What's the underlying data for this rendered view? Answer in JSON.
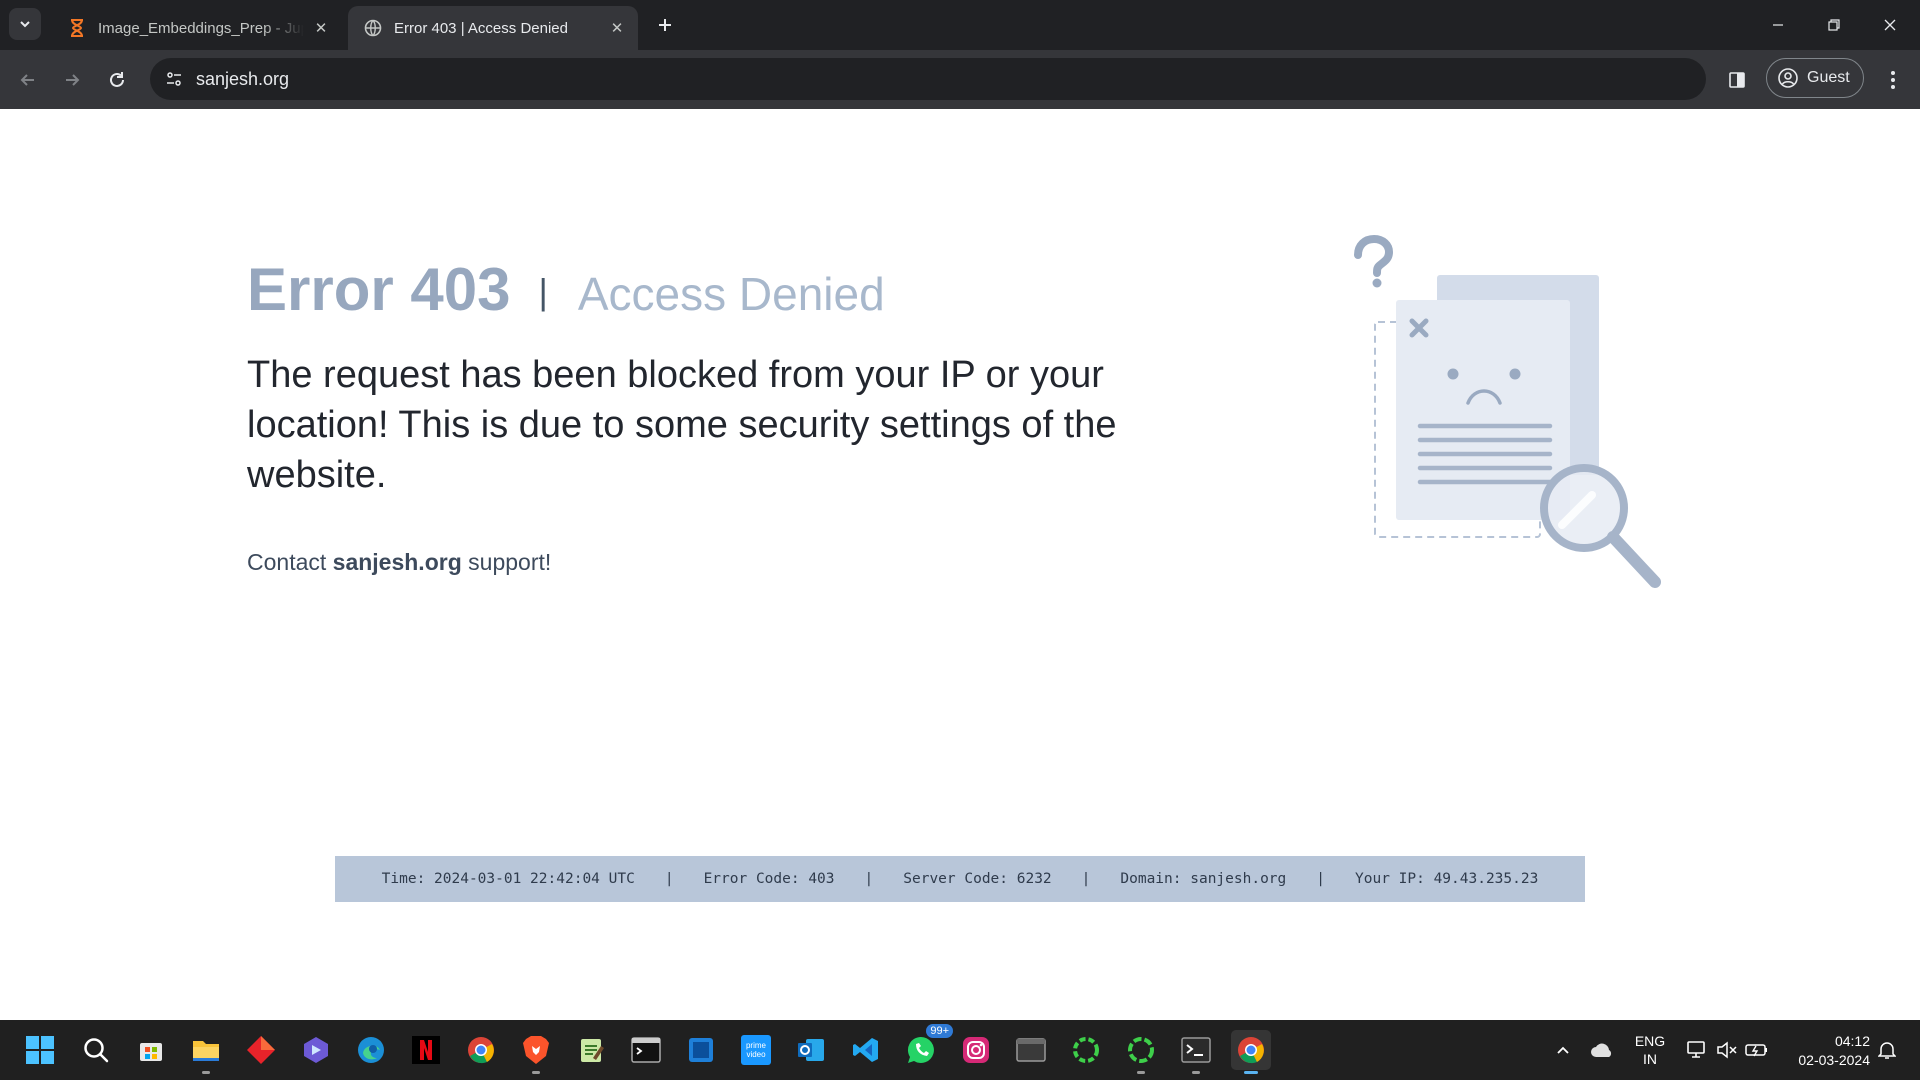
{
  "browser": {
    "tabs": [
      {
        "title": "Image_Embeddings_Prep - Jupyter",
        "icon": "hourglass-icon",
        "active": false
      },
      {
        "title": "Error 403  | Access Denied",
        "icon": "globe-icon",
        "active": true
      }
    ],
    "url": "sanjesh.org",
    "profile_label": "Guest"
  },
  "page": {
    "error_code": "Error 403",
    "separator": "|",
    "error_title": "Access Denied",
    "message": "The request has been blocked from your IP or your location! This is due to some security settings of the website.",
    "contact_prefix": "Contact ",
    "contact_domain": "sanjesh.org",
    "contact_suffix": " support!",
    "info": {
      "time": "Time: 2024-03-01 22:42:04 UTC",
      "error_code": "Error Code: 403",
      "server_code": "Server Code: 6232",
      "domain": "Domain: sanjesh.org",
      "ip": "Your IP: 49.43.235.23"
    }
  },
  "taskbar": {
    "apps": [
      "start-icon",
      "search-icon",
      "store-icon",
      "file-explorer-icon",
      "app-diamond-icon",
      "app-hex-icon",
      "edge-icon",
      "netflix-icon",
      "chrome-icon",
      "brave-icon",
      "notepad-icon",
      "terminal-icon",
      "app-tile-icon",
      "prime-video-icon",
      "outlook-icon",
      "vscode-icon",
      "whatsapp-icon",
      "instagram-icon",
      "window-icon",
      "app-ring-icon",
      "app-ring2-icon",
      "powershell-icon",
      "chrome-active-icon"
    ],
    "whatsapp_badge": "99+",
    "language_line1": "ENG",
    "language_line2": "IN",
    "time": "04:12",
    "date": "02-03-2024"
  },
  "colors": {
    "chrome_dark": "#202124",
    "chrome_toolbar": "#35363a",
    "heading_code": "#97a7be",
    "heading_text": "#a8b8cc",
    "info_bar": "#b8c6d9"
  }
}
